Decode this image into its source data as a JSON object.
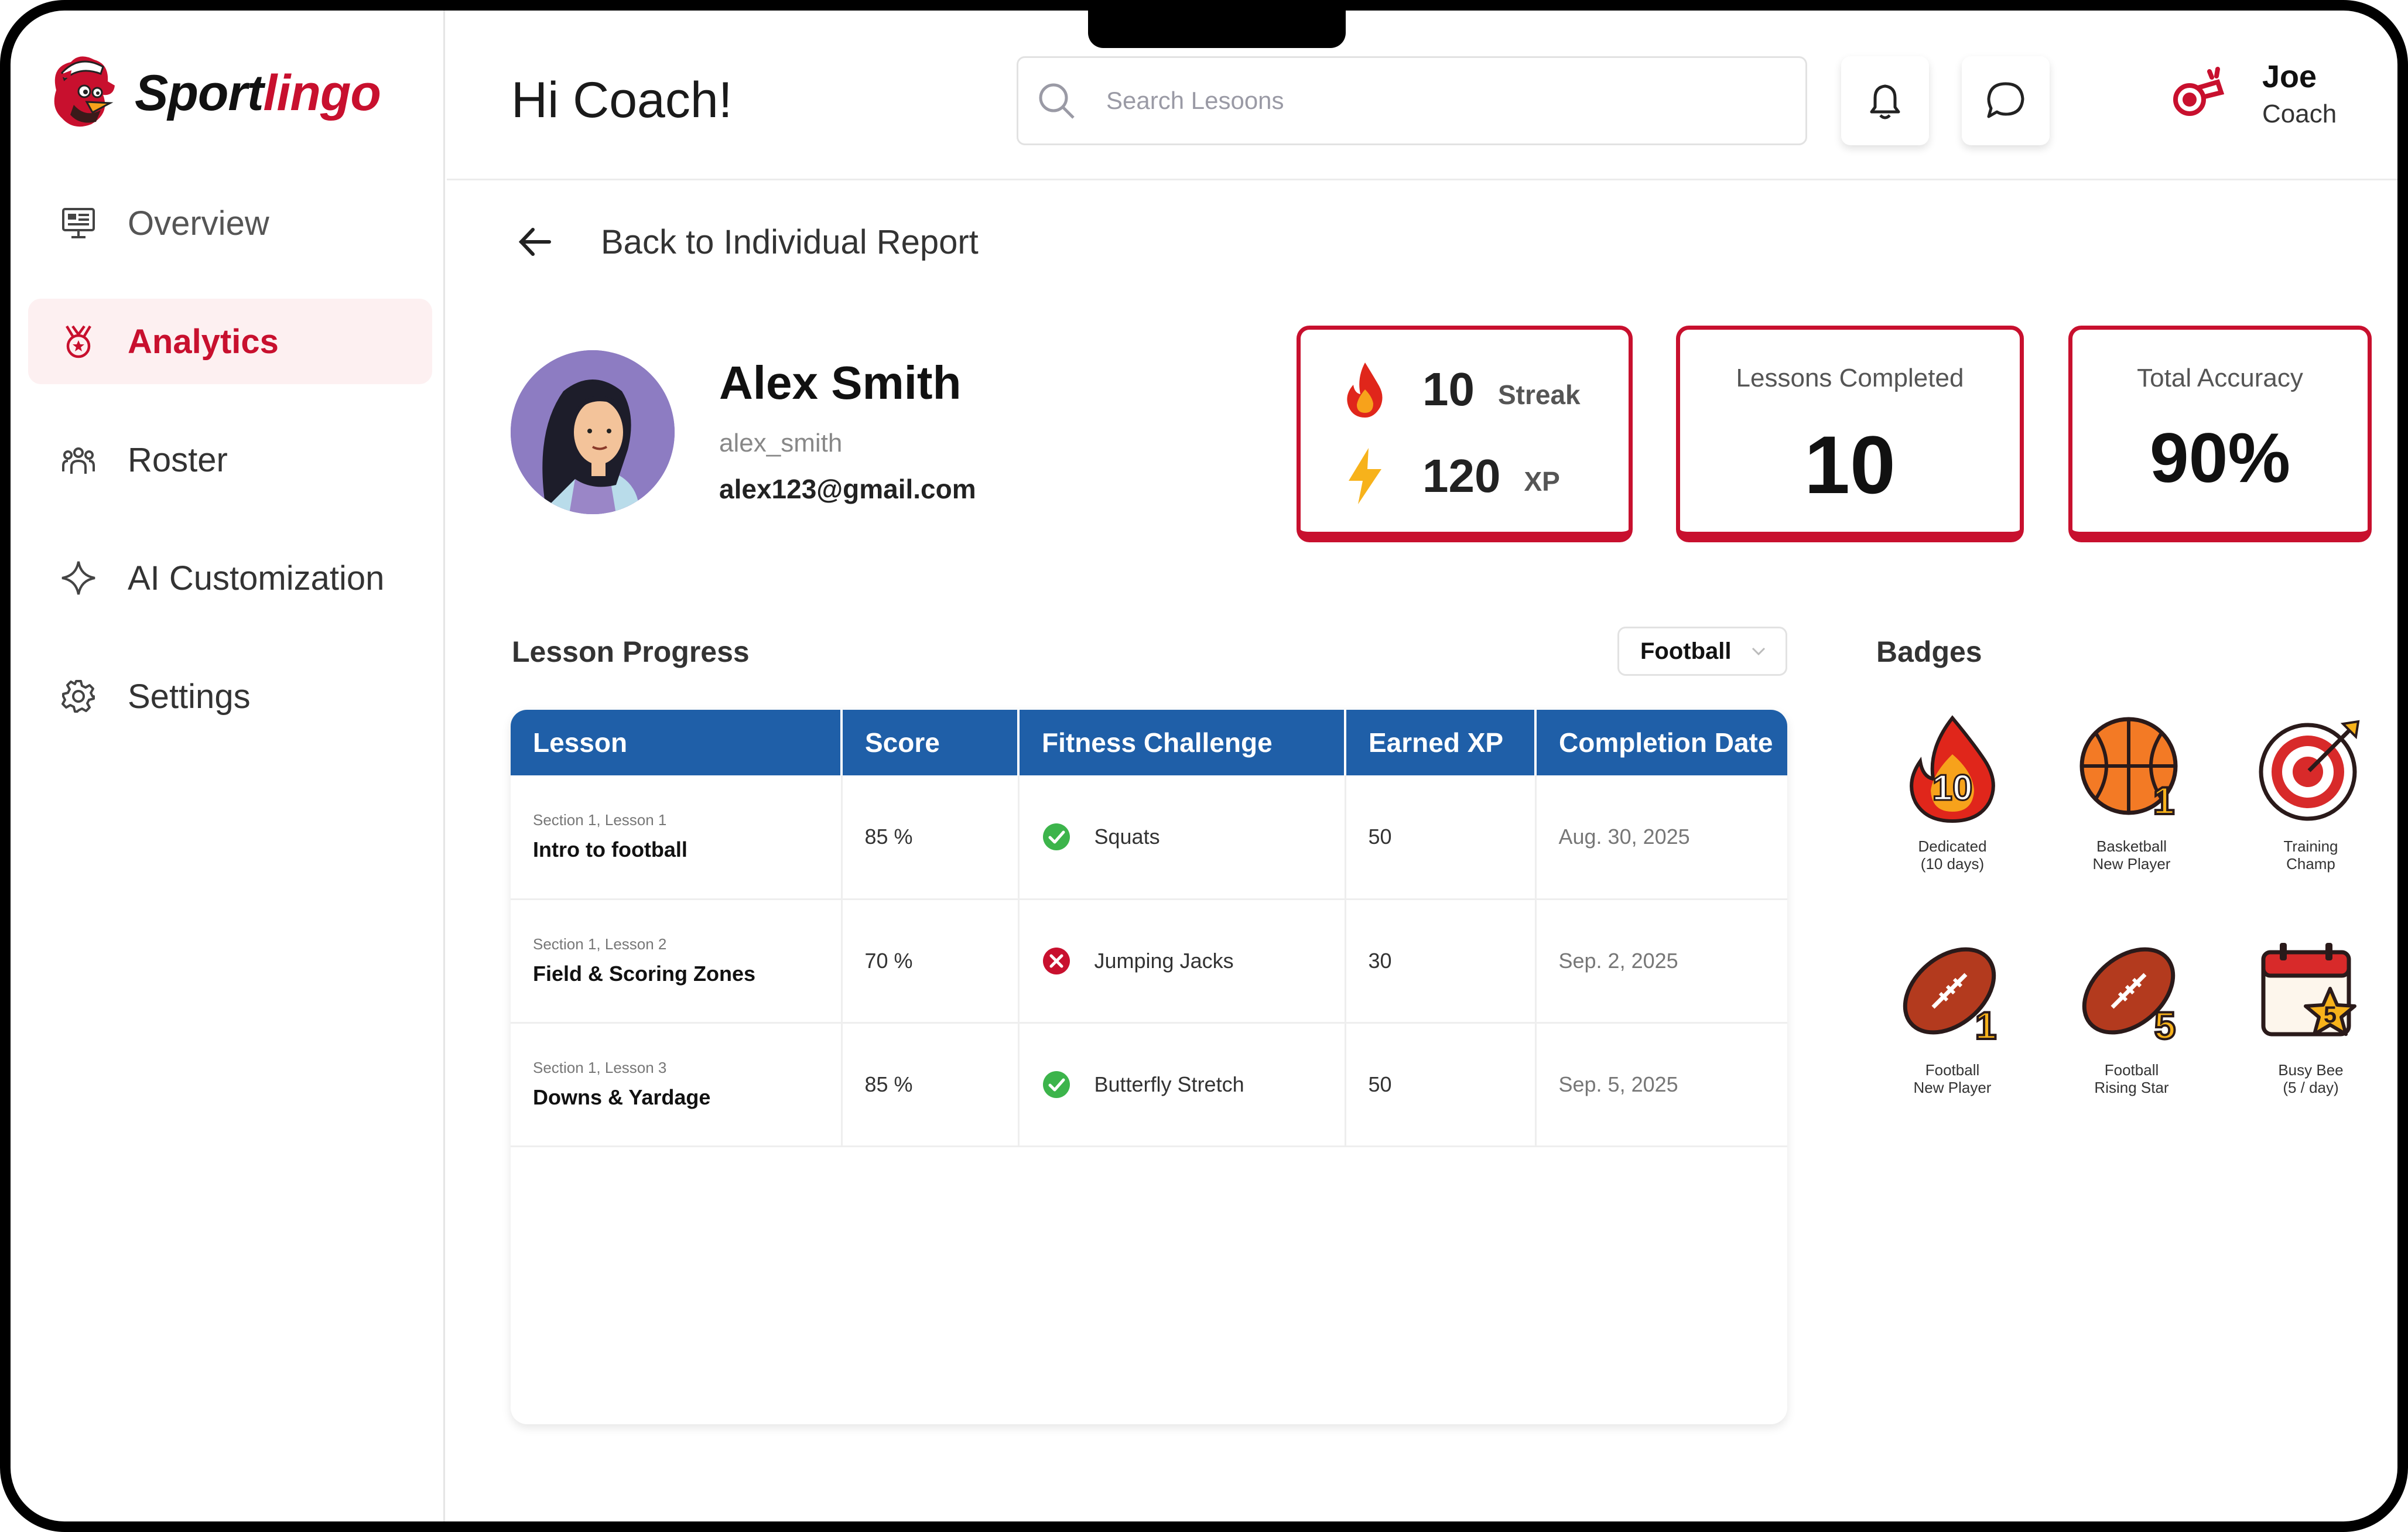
{
  "app": {
    "brand_part1": "Sport",
    "brand_part2": "lingo"
  },
  "sidebar": {
    "items": [
      {
        "label": "Overview",
        "icon": "monitor-icon",
        "active": false
      },
      {
        "label": "Analytics",
        "icon": "analytics-medal-icon",
        "active": true
      },
      {
        "label": "Roster",
        "icon": "roster-users-icon",
        "active": false
      },
      {
        "label": "AI Customization",
        "icon": "sparkle-icon",
        "active": false
      },
      {
        "label": "Settings",
        "icon": "gear-icon",
        "active": false
      }
    ]
  },
  "header": {
    "greeting": "Hi Coach!",
    "search_placeholder": "Search Lesoons",
    "user_name": "Joe",
    "user_role": "Coach"
  },
  "main": {
    "back_label": "Back to Individual Report",
    "profile": {
      "name": "Alex Smith",
      "username": "alex_smith",
      "email": "alex123@gmail.com"
    },
    "stats": {
      "streak_value": "10",
      "streak_label": "Streak",
      "xp_value": "120",
      "xp_label": "XP",
      "lessons_label": "Lessons Completed",
      "lessons_value": "10",
      "accuracy_label": "Total Accuracy",
      "accuracy_value": "90%"
    },
    "lesson_progress": {
      "title": "Lesson Progress",
      "filter": "Football",
      "columns": [
        "Lesson",
        "Score",
        "Fitness Challenge",
        "Earned XP",
        "Completion Date"
      ],
      "rows": [
        {
          "section": "Section 1, Lesson 1",
          "lesson": "Intro to football",
          "score": "85 %",
          "challenge": "Squats",
          "status": "pass",
          "xp": "50",
          "date": "Aug. 30, 2025"
        },
        {
          "section": "Section 1, Lesson 2",
          "lesson": "Field & Scoring Zones",
          "score": "70 %",
          "challenge": "Jumping Jacks",
          "status": "fail",
          "xp": "30",
          "date": "Sep. 2, 2025"
        },
        {
          "section": "Section 1, Lesson 3",
          "lesson": "Downs & Yardage",
          "score": "85 %",
          "challenge": "Butterfly Stretch",
          "status": "pass",
          "xp": "50",
          "date": "Sep. 5, 2025"
        }
      ]
    },
    "badges": {
      "title": "Badges",
      "items": [
        {
          "line1": "Dedicated",
          "line2": "(10 days)",
          "icon": "flame-10-badge-icon",
          "number": "10"
        },
        {
          "line1": "Basketball",
          "line2": "New Player",
          "icon": "basketball-badge-icon",
          "number": "1"
        },
        {
          "line1": "Training",
          "line2": "Champ",
          "icon": "target-badge-icon",
          "number": ""
        },
        {
          "line1": "Football",
          "line2": "New Player",
          "icon": "football-badge-icon",
          "number": "1"
        },
        {
          "line1": "Football",
          "line2": "Rising Star",
          "icon": "football-badge-icon",
          "number": "5"
        },
        {
          "line1": "Busy Bee",
          "line2": "(5 / day)",
          "icon": "calendar-star-badge-icon",
          "number": "5"
        }
      ]
    }
  },
  "colors": {
    "brand_red": "#c8102e",
    "table_header_blue": "#1f5fa8",
    "success_green": "#3cb44b",
    "active_nav_bg": "#fdf0f1"
  }
}
